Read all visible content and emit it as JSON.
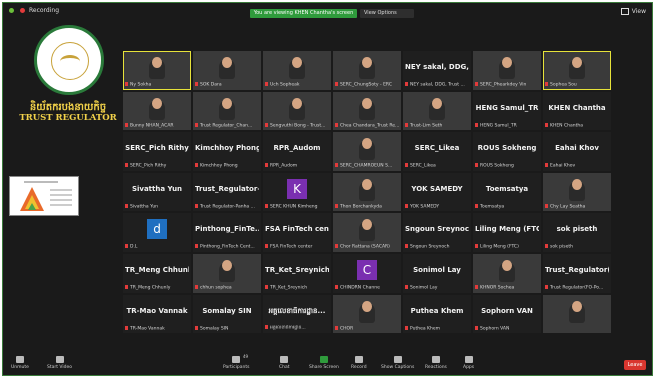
{
  "topbar": {
    "recording_label": "Recording",
    "banner": "You are viewing KHEN Chantha's screen",
    "view_options": "View Options",
    "view_label": "View"
  },
  "brand": {
    "khmer_name": "និយ័តករបងនាយកិច្ច",
    "english_name": "TRUST REGULATOR",
    "seal_text": "TRUST REGULATOR"
  },
  "tiles": [
    {
      "big": "",
      "name": "Ny Sokha",
      "video": true,
      "hl": true
    },
    {
      "big": "",
      "name": "SOK Dara",
      "video": true,
      "hl": false
    },
    {
      "big": "",
      "name": "Uch Sopheak",
      "video": true,
      "hl": false
    },
    {
      "big": "",
      "name": "SERC_ChungSoty - ERC",
      "video": true,
      "hl": false
    },
    {
      "big": "NEY sakal, DDG,...",
      "name": "NEY sakal, DDG, Trust ...",
      "video": false,
      "hl": false
    },
    {
      "big": "",
      "name": "SERC_Phearkdey Vin",
      "video": true,
      "hl": false
    },
    {
      "big": "",
      "name": "Sophea Sou",
      "video": true,
      "hl": true
    },
    {
      "big": "",
      "name": "Bunny NHAN_ACAR",
      "video": true,
      "hl": false
    },
    {
      "big": "",
      "name": "Trust Regulator_Chan...",
      "video": true,
      "hl": false
    },
    {
      "big": "",
      "name": "Sengvuthi Bong - Trust...",
      "video": true,
      "hl": false
    },
    {
      "big": "",
      "name": "Chea Chandara_Trust Re...",
      "video": true,
      "hl": false
    },
    {
      "big": "",
      "name": "Trust-Lim Seth",
      "video": true,
      "hl": false
    },
    {
      "big": "HENG Samul_TR",
      "name": "HENG Samul_TR",
      "video": false,
      "hl": false
    },
    {
      "big": "KHEN Chantha",
      "name": "KHEN Chantha",
      "video": false,
      "hl": false
    },
    {
      "big": "SERC_Pich Rithy",
      "name": "SERC_Pich Rithy",
      "video": false,
      "hl": false
    },
    {
      "big": "Kimchhoy Phong",
      "name": "Kimchhoy Phong",
      "video": false,
      "hl": false
    },
    {
      "big": "RPR_Audom",
      "name": "RPR_Audom",
      "video": false,
      "hl": false
    },
    {
      "big": "",
      "name": "SERC_CHAMROEUN S...",
      "video": true,
      "hl": false
    },
    {
      "big": "SERC_Likea",
      "name": "SERC_Likea",
      "video": false,
      "hl": false
    },
    {
      "big": "ROUS Sokheng",
      "name": "ROUS Sokheng",
      "video": false,
      "hl": false
    },
    {
      "big": "Eahai Khov",
      "name": "Eahai Khov",
      "video": false,
      "hl": false
    },
    {
      "big": "Sivattha Yun",
      "name": "Sivattha Yun",
      "video": false,
      "hl": false
    },
    {
      "big": "Trust_Regulator-...",
      "name": "Trust Regulator-Panha ...",
      "video": false,
      "hl": false
    },
    {
      "big": "",
      "name": "SERC KHUN Kimheng",
      "video": false,
      "hl": false,
      "avatar": "K",
      "avatar_color": "#7a2fb0"
    },
    {
      "big": "",
      "name": "Thon Borchankyda",
      "video": true,
      "hl": false
    },
    {
      "big": "YOK SAMEDY",
      "name": "YOK SAMEDY",
      "video": false,
      "hl": false
    },
    {
      "big": "Toemsatya",
      "name": "Toemsatya",
      "video": false,
      "hl": false
    },
    {
      "big": "",
      "name": "Chy Lay Seatha",
      "video": true,
      "hl": false
    },
    {
      "big": "",
      "name": "D.L",
      "video": false,
      "hl": false,
      "avatar": "d",
      "avatar_color": "#1f6fc0"
    },
    {
      "big": "Pinthong_FinTe...",
      "name": "Pinthong_FinTech Cent...",
      "video": false,
      "hl": false
    },
    {
      "big": "FSA FinTech cent...",
      "name": "FSA FinTech center",
      "video": false,
      "hl": false
    },
    {
      "big": "",
      "name": "Chor Rattana (SACAR)",
      "video": true,
      "hl": false
    },
    {
      "big": "Sngoun Sreynoch",
      "name": "Sngoun Sreynoch",
      "video": false,
      "hl": false
    },
    {
      "big": "Liling Meng (FTC)",
      "name": "Liling Meng (FTC)",
      "video": false,
      "hl": false
    },
    {
      "big": "sok piseth",
      "name": "sok piseth",
      "video": false,
      "hl": false
    },
    {
      "big": "TR_Meng Chhunly",
      "name": "TR_Meng Chhunly",
      "video": false,
      "hl": false
    },
    {
      "big": "",
      "name": "chhun sophea",
      "video": true,
      "hl": false
    },
    {
      "big": "TR_Ket_Sreynich",
      "name": "TR_Ket_Sreynich",
      "video": false,
      "hl": false
    },
    {
      "big": "",
      "name": "CHINDRN Channe",
      "video": false,
      "hl": false,
      "avatar": "C",
      "avatar_color": "#7a2fb0"
    },
    {
      "big": "Sonimol Lay",
      "name": "Sonimol Lay",
      "video": false,
      "hl": false
    },
    {
      "big": "",
      "name": "KHNOR Sochea",
      "video": true,
      "hl": false
    },
    {
      "big": "Trust_Regulator(...",
      "name": "Trust Regulator(FO-Po...",
      "video": false,
      "hl": false
    },
    {
      "big": "TR-Mao Vannak",
      "name": "TR-Mao Vannak",
      "video": false,
      "hl": false
    },
    {
      "big": "Somalay SIN",
      "name": "Somalay SIN",
      "video": false,
      "hl": false
    },
    {
      "big": "អគ្គលេខាធិការដ្ឋាន...",
      "name": "អគ្គលេខាធិការដ្ឋាន...",
      "video": false,
      "hl": false
    },
    {
      "big": "",
      "name": "CHOR",
      "video": true,
      "hl": false
    },
    {
      "big": "Puthea Khem",
      "name": "Puthea Khem",
      "video": false,
      "hl": false
    },
    {
      "big": "Sophorn VAN",
      "name": "Sophorn VAN",
      "video": false,
      "hl": false
    },
    {
      "big": "",
      "name": "",
      "video": true,
      "hl": false
    }
  ],
  "bottombar": {
    "unmute": "Unmute",
    "start_video": "Start Video",
    "participants": "Participants",
    "participants_count": "49",
    "chat": "Chat",
    "share_screen": "Share Screen",
    "record": "Record",
    "show_captions": "Show Captions",
    "reactions": "Reactions",
    "apps": "Apps",
    "leave": "Leave"
  },
  "colors": {
    "share_green": "#2f9b3c",
    "leave_red": "#d9362f",
    "brand_gold": "#f2d24a",
    "speaker_highlight": "#e6e23a"
  }
}
